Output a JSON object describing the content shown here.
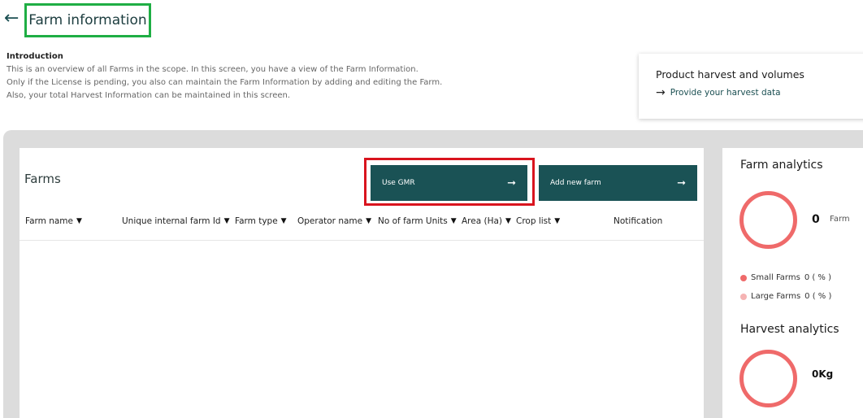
{
  "header": {
    "title": "Farm information"
  },
  "intro": {
    "heading": "Introduction",
    "lines": [
      "This is an overview of all Farms in the scope. In this screen, you have a view of the Farm Information.",
      "Only if the License is pending, you also can maintain the Farm Information by adding and editing the Farm.",
      "Also, your total Harvest Information can be maintained in this screen."
    ]
  },
  "harvest_card": {
    "title": "Product harvest and volumes",
    "link": "Provide your  harvest data"
  },
  "farms": {
    "title": "Farms",
    "use_gmr_label": "Use GMR",
    "add_farm_label": "Add new farm",
    "columns": [
      "Farm name",
      "Unique internal farm Id",
      "Farm type",
      "Operator name",
      "No of farm Units",
      "Area (Ha)",
      "Crop list",
      "Notification"
    ]
  },
  "analytics": {
    "farm_title": "Farm analytics",
    "farm_count": "0",
    "farm_unit": "Farm",
    "small_farms": "Small Farms",
    "small_value": "0 ( % )",
    "large_farms": "Large Farms",
    "large_value": "0 ( % )",
    "harvest_title": "Harvest analytics",
    "harvest_value": "0Kg"
  },
  "colors": {
    "primary": "#1a5255",
    "donut": "#ef6a6a",
    "small_dot": "#ef6a6a",
    "large_dot": "#f5b3b3",
    "highlight_green": "#1fae44",
    "highlight_red": "#d9141e"
  }
}
